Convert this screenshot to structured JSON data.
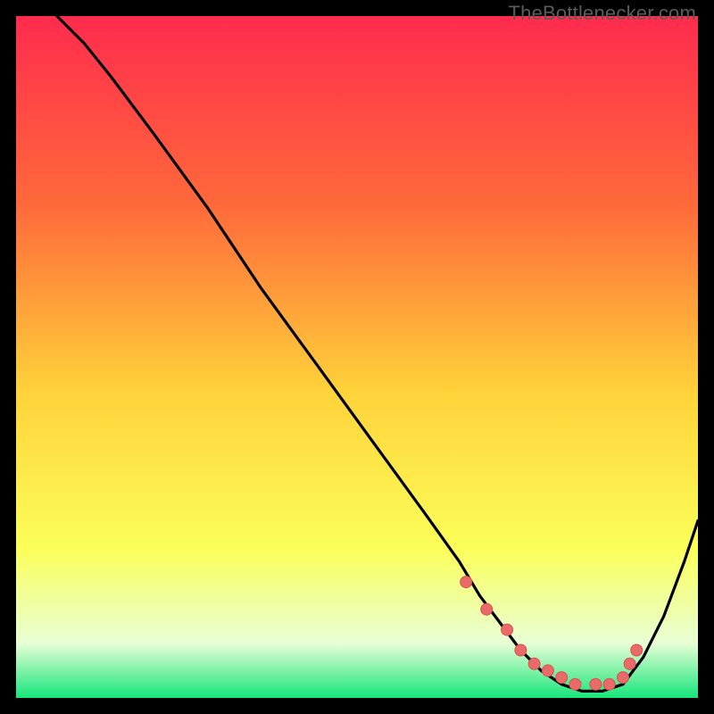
{
  "watermark": "TheBottlenecker.com",
  "colors": {
    "gradient_top": "#ff2b4e",
    "gradient_mid1": "#ff6a3a",
    "gradient_mid2": "#ffd23a",
    "gradient_mid3": "#fbff58",
    "gradient_bottom_band": "#e8ffd6",
    "gradient_bottom": "#16e57a",
    "curve": "#000000",
    "point_fill": "#e96a68",
    "point_stroke": "#d9524f"
  },
  "chart_data": {
    "type": "line",
    "title": "",
    "xlabel": "",
    "ylabel": "",
    "xlim": [
      0,
      100
    ],
    "ylim": [
      0,
      100
    ],
    "series": [
      {
        "name": "bottleneck-curve",
        "x": [
          6,
          10,
          14,
          20,
          28,
          36,
          44,
          52,
          60,
          65,
          68,
          71,
          74,
          77,
          80,
          83,
          86,
          89,
          92,
          95,
          98,
          100
        ],
        "y": [
          100,
          96,
          91,
          83,
          72,
          60,
          49,
          38,
          27,
          20,
          15,
          11,
          7,
          4,
          2,
          1,
          1,
          2,
          6,
          12,
          20,
          26
        ]
      }
    ],
    "points": {
      "name": "highlight-points",
      "x": [
        66,
        69,
        72,
        74,
        76,
        78,
        80,
        82,
        85,
        87,
        89,
        90,
        91
      ],
      "y": [
        17,
        13,
        10,
        7,
        5,
        4,
        3,
        2,
        2,
        2,
        3,
        5,
        7
      ]
    }
  }
}
